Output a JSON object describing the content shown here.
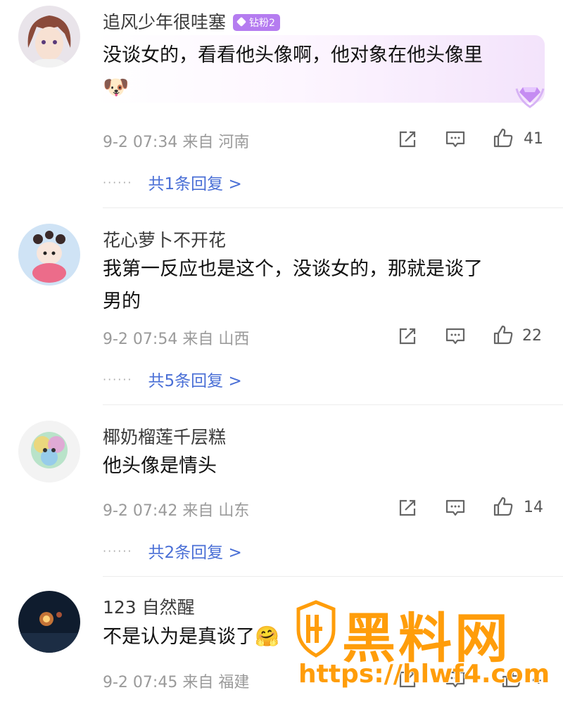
{
  "comments": [
    {
      "username": "追风少年很哇塞",
      "badge": "钻粉2",
      "text": "没谈女的，看看他头像啊，他对象在他头像里",
      "emoji": "🐶",
      "time": "9-2 07:34",
      "from": "来自",
      "location": "河南",
      "likes": "41",
      "replies": "共1条回复 >",
      "reply_dots": "······"
    },
    {
      "username": "花心萝卜不开花",
      "text_line1": "我第一反应也是这个，没谈女的，那就是谈了",
      "text_line2": "男的",
      "time": "9-2 07:54",
      "from": "来自",
      "location": "山西",
      "likes": "22",
      "replies": "共5条回复 >",
      "reply_dots": "······"
    },
    {
      "username": "椰奶榴莲千层糕",
      "text": "他头像是情头",
      "time": "9-2 07:42",
      "from": "来自",
      "location": "山东",
      "likes": "14",
      "replies": "共2条回复 >",
      "reply_dots": "······"
    },
    {
      "username": "123 自然醒",
      "text": "不是认为是真谈了",
      "emoji": "🤗",
      "time": "9-2 07:45",
      "from": "来自",
      "location": "福建",
      "likes": "4"
    }
  ],
  "watermark": {
    "title": "黑料网",
    "url": "https://hlwf4.com"
  },
  "colors": {
    "link": "#4a6fd6",
    "meta": "#9a9a9a",
    "badge": "#b57cf0",
    "watermark": "#ff9d0a"
  },
  "icons": [
    "quote-share-icon",
    "comment-icon",
    "like-icon",
    "diamond-fan-icon"
  ]
}
